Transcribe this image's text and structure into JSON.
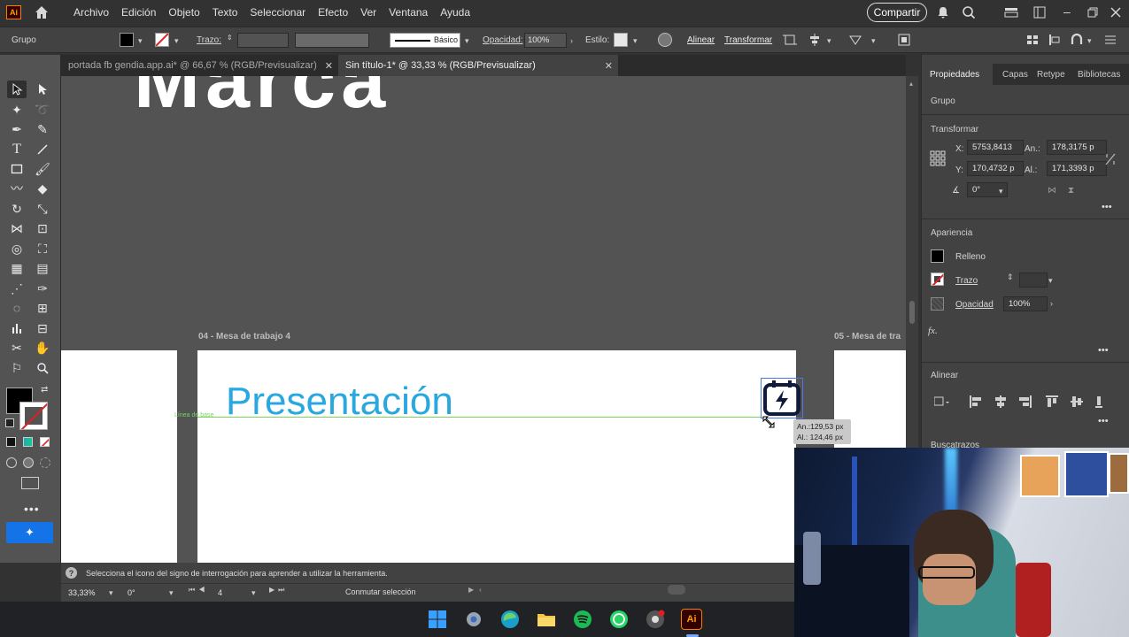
{
  "menubar": {
    "logo": "Ai",
    "items": [
      "Archivo",
      "Edición",
      "Objeto",
      "Texto",
      "Seleccionar",
      "Efecto",
      "Ver",
      "Ventana",
      "Ayuda"
    ],
    "share": "Compartir"
  },
  "controlbar": {
    "selection_type": "Grupo",
    "stroke_label": "Trazo:",
    "brush_label": "Básico",
    "opacity_label": "Opacidad:",
    "opacity_value": "100%",
    "style_label": "Estilo:",
    "align_label": "Alinear",
    "transform_label": "Transformar"
  },
  "tabs": [
    {
      "label": "portada fb gendia.app.ai* @ 66,67 % (RGB/Previsualizar)",
      "active": false
    },
    {
      "label": "Sin título-1* @ 33,33 % (RGB/Previsualizar)",
      "active": true
    }
  ],
  "canvas": {
    "artboard_main_label": "04 - Mesa de trabajo 4",
    "artboard_right_label": "05 - Mesa de tra",
    "title_text": "Presentación",
    "baseline_hint": "Línea de base",
    "size_tip_w": "An.:129,53 px",
    "size_tip_h": "Al.: 124,46 px",
    "title_color": "#29a8e0"
  },
  "props": {
    "tabs": [
      "Propiedades",
      "Capas",
      "Retype",
      "Bibliotecas"
    ],
    "selection": "Grupo",
    "transform_title": "Transformar",
    "x_label": "X:",
    "x_value": "5753,8413",
    "y_label": "Y:",
    "y_value": "170,4732 p",
    "w_label": "An.:",
    "w_value": "178,3175 p",
    "h_label": "Al.:",
    "h_value": "171,3393 p",
    "angle_value": "0°",
    "appearance_title": "Apariencia",
    "fill_label": "Relleno",
    "stroke_label": "Trazo",
    "opacity_label": "Opacidad",
    "opacity_value": "100%",
    "fx_label": "fx.",
    "align_title": "Alinear",
    "pathfinder_title": "Buscatrazos"
  },
  "status": {
    "help": "Selecciona el icono del signo de interrogación para aprender a utilizar la herramienta.",
    "zoom": "33,33%",
    "rotation": "0°",
    "artboard_num": "4",
    "mode": "Conmutar selección"
  },
  "taskbar": {
    "icons": [
      "windows-start-icon",
      "settings-icon",
      "edge-icon",
      "file-explorer-icon",
      "spotify-icon",
      "whatsapp-icon",
      "chrome-icon",
      "illustrator-icon"
    ]
  }
}
